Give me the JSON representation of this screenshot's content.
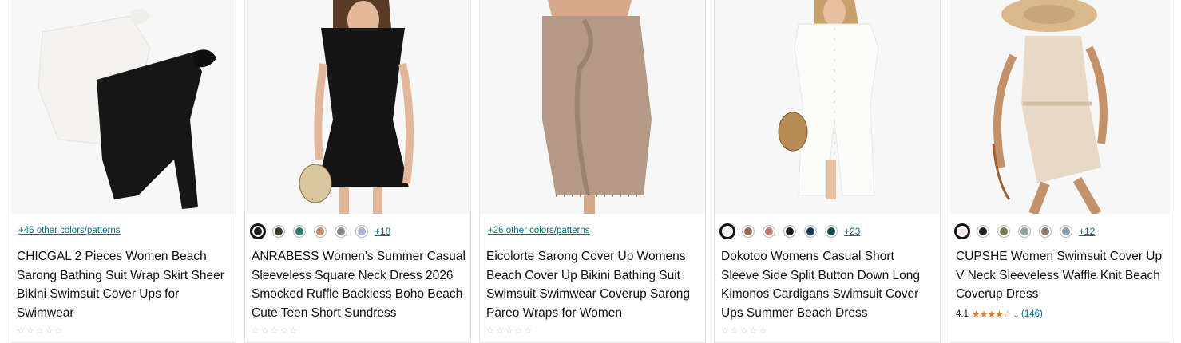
{
  "products": [
    {
      "title": "CHICGAL 2 Pieces Women Beach Sarong Bathing Suit Wrap Skirt Sheer Bikini Swimsuit Cover Ups for Swimwear",
      "colors_link": "+46 other colors/patterns"
    },
    {
      "title": "ANRABESS Women's Summer Casual Sleeveless Square Neck Dress 2026 Smocked Ruffle Backless Boho Beach Cute Teen Short Sundress",
      "swatches": [
        "#1a1a1a",
        "#3b3a25",
        "#2e7b73",
        "#c98b6c",
        "#8a8a8a",
        "#a9b4d6"
      ],
      "more": "+18"
    },
    {
      "title": "Eicolorte Sarong Cover Up Womens Beach Cover Up Bikini Bathing Suit Swimsuit Swimwear Coverup Sarong Pareo Wraps for Women",
      "colors_link": "+26 other colors/patterns"
    },
    {
      "title": "Dokotoo Womens Casual Short Sleeve Side Split Button Down Long Kimonos Cardigans Swimsuit Cover Ups Summer Beach Dress",
      "swatches": [
        "#f2f2f2",
        "#9c6b5a",
        "#c77a6e",
        "#1d1d1d",
        "#143a5c",
        "#114d4f"
      ],
      "more": "+23"
    },
    {
      "title": "CUPSHE Women Swimsuit Cover Up V Neck Sleeveless Waffle Knit Beach Coverup Dress",
      "swatches": [
        "#f3e6e3",
        "#1e1e1e",
        "#7b7a4e",
        "#8aa79c",
        "#8b7b6e",
        "#8a9fb3"
      ],
      "more": "+12",
      "rating": "4.1",
      "stars": "★★★★☆",
      "review_count": "(146)"
    }
  ]
}
